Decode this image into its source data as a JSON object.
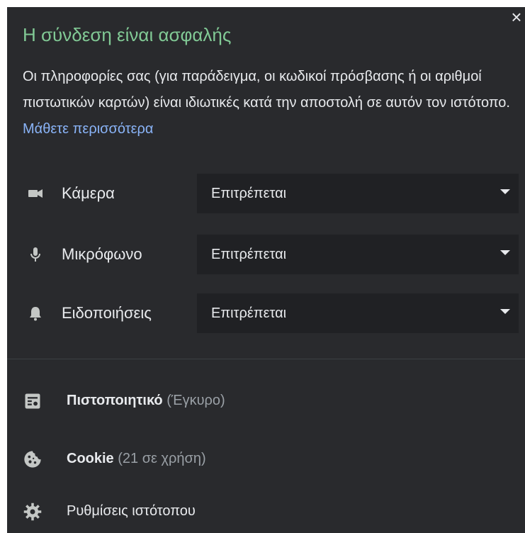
{
  "header": {
    "title": "Η σύνδεση είναι ασφαλής",
    "close_glyph": "×",
    "description": "Οι πληροφορίες σας (για παράδειγμα, οι κωδικοί πρόσβασης ή οι αριθμοί πιστωτικών καρτών) είναι ιδιωτικές κατά την αποστολή σε αυτόν τον ιστότοπο.",
    "learn_more": "Μάθετε περισσότερα"
  },
  "permissions": [
    {
      "icon": "camera-icon",
      "label": "Κάμερα",
      "value": "Επιτρέπεται"
    },
    {
      "icon": "microphone-icon",
      "label": "Μικρόφωνο",
      "value": "Επιτρέπεται"
    },
    {
      "icon": "bell-icon",
      "label": "Ειδοποιήσεις",
      "value": "Επιτρέπεται"
    }
  ],
  "links": [
    {
      "icon": "certificate-icon",
      "label": "Πιστοποιητικό",
      "detail": "(Έγκυρο)"
    },
    {
      "icon": "cookie-icon",
      "label": "Cookie",
      "detail": "(21 σε χρήση)"
    },
    {
      "icon": "gear-icon",
      "label": "Ρυθμίσεις ιστότοπου",
      "detail": ""
    }
  ],
  "colors": {
    "panel_bg": "#292a2d",
    "select_bg": "#202124",
    "secure_green": "#81c995",
    "link_blue": "#8ab4f8",
    "text": "#e8eaed",
    "muted": "#9aa0a6"
  }
}
